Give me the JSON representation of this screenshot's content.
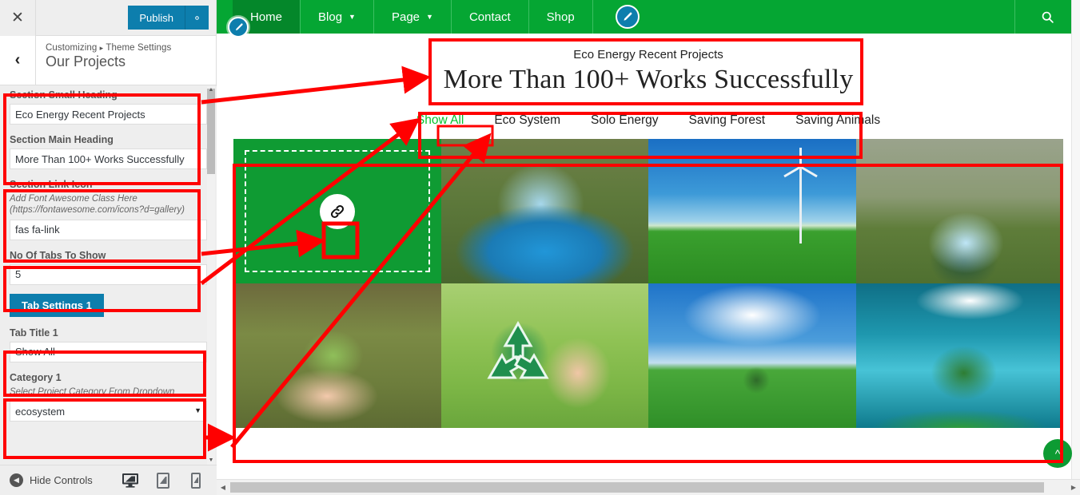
{
  "customizer": {
    "close_icon": "close-icon",
    "publish_label": "Publish",
    "gear_icon": "gear-icon",
    "back_icon": "chevron-left-icon",
    "breadcrumb_root": "Customizing",
    "breadcrumb_sep": "▸",
    "breadcrumb_parent": "Theme Settings",
    "panel_title": "Our Projects",
    "controls": [
      {
        "label": "Section Small Heading",
        "desc": "",
        "value": "Eco Energy Recent Projects",
        "type": "text"
      },
      {
        "label": "Section Main Heading",
        "desc": "",
        "value": "More Than 100+ Works Successfully",
        "type": "text"
      },
      {
        "label": "Section Link Icon",
        "desc": "Add Font Awesome Class Here (https://fontawesome.com/icons?d=gallery)",
        "value": "fas fa-link",
        "type": "text"
      },
      {
        "label": "No Of Tabs To Show",
        "desc": "",
        "value": "5",
        "type": "text"
      },
      {
        "label": "Tab Title 1",
        "desc": "",
        "value": "Show All",
        "type": "text"
      },
      {
        "label": "Category 1",
        "desc": "Select Project Category From Dropdown",
        "value": "ecosystem",
        "type": "select"
      }
    ],
    "tab_settings_button": "Tab Settings 1",
    "footer": {
      "hide_controls_label": "Hide Controls",
      "collapse_icon": "collapse-arrow-icon",
      "devices": [
        {
          "name": "desktop-preview",
          "icon": "desktop-icon",
          "active": true
        },
        {
          "name": "tablet-preview",
          "icon": "tablet-icon",
          "active": false
        },
        {
          "name": "mobile-preview",
          "icon": "mobile-icon",
          "active": false
        }
      ]
    }
  },
  "preview": {
    "nav": {
      "items": [
        {
          "label": "Home",
          "has_caret": false,
          "active": true
        },
        {
          "label": "Blog",
          "has_caret": true,
          "active": false
        },
        {
          "label": "Page",
          "has_caret": true,
          "active": false
        },
        {
          "label": "Contact",
          "has_caret": false,
          "active": false
        },
        {
          "label": "Shop",
          "has_caret": false,
          "active": false
        }
      ],
      "edit_icon": "pencil-edit-icon",
      "search_icon": "search-icon",
      "bar_color": "#05a633",
      "active_color": "#04872a"
    },
    "section": {
      "edit_icon": "pencil-edit-icon",
      "small_heading": "Eco Energy Recent Projects",
      "main_heading": "More Than 100+ Works Successfully"
    },
    "tabs": [
      {
        "label": "Show All",
        "active": true
      },
      {
        "label": "Eco System",
        "active": false
      },
      {
        "label": "Solo Energy",
        "active": false
      },
      {
        "label": "Saving Forest",
        "active": false
      },
      {
        "label": "Saving Animals",
        "active": false
      }
    ],
    "tab_active_color": "#05c22e",
    "gallery": [
      {
        "name": "project-tile-volunteers",
        "style": "hovered",
        "link_icon": "link-icon"
      },
      {
        "name": "project-tile-recycle-bin",
        "style": "ph-recycle-bin",
        "link_icon": ""
      },
      {
        "name": "project-tile-windmill",
        "style": "ph-windmill",
        "link_icon": ""
      },
      {
        "name": "project-tile-bottle-bin",
        "style": "ph-bottle-bin",
        "link_icon": ""
      },
      {
        "name": "project-tile-sapling-hands",
        "style": "ph-sapling",
        "link_icon": ""
      },
      {
        "name": "project-tile-recycle-symbol",
        "style": "ph-recycle-sym",
        "link_icon": ""
      },
      {
        "name": "project-tile-tree-field",
        "style": "ph-tree-field",
        "link_icon": ""
      },
      {
        "name": "project-tile-tree-globe",
        "style": "ph-tree-globe",
        "link_icon": ""
      }
    ],
    "back_to_top_icon": "chevron-up-icon",
    "back_to_top_color": "#0d9b33"
  },
  "annotation": {
    "color": "#ff0000",
    "boxes": [
      "section-headings-control-box",
      "section-link-icon-control-box",
      "no-of-tabs-control-box",
      "tab-title-control-box",
      "category-control-box",
      "preview-headings-box",
      "preview-tabs-box",
      "preview-show-all-box",
      "preview-link-icon-box",
      "preview-gallery-box"
    ]
  }
}
